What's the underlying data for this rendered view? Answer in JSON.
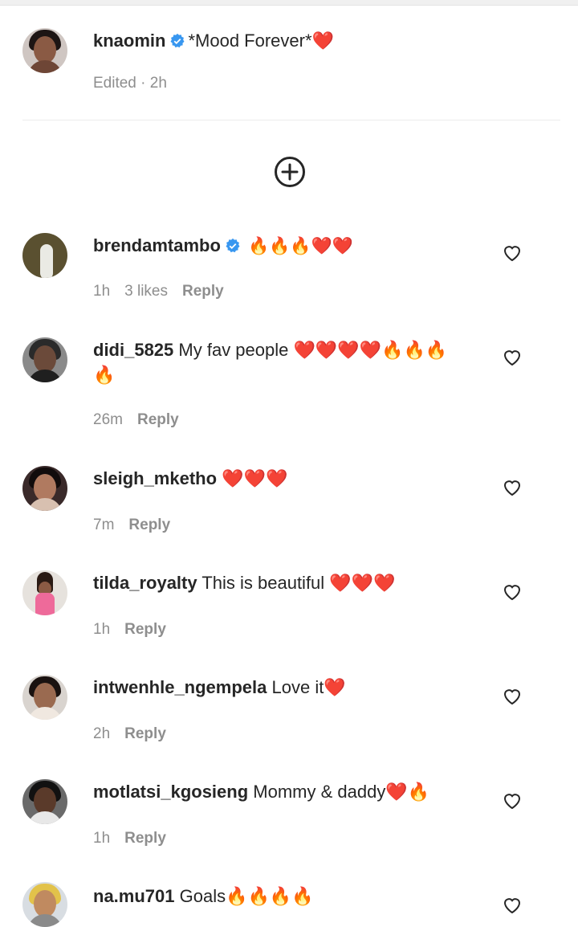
{
  "caption": {
    "username": "knaomin",
    "text": "*Mood Forever*❤️",
    "meta": "Edited · 2h"
  },
  "comments": [
    {
      "username": "brendamtambo",
      "verified": true,
      "text": "🔥🔥🔥❤️❤️",
      "time": "1h",
      "likes": "3 likes",
      "reply": "Reply"
    },
    {
      "username": "didi_5825",
      "text": "My fav people ❤️❤️❤️❤️🔥🔥🔥",
      "text2": "🔥",
      "time": "26m",
      "reply": "Reply"
    },
    {
      "username": "sleigh_mketho",
      "text": "❤️❤️❤️",
      "time": "7m",
      "reply": "Reply"
    },
    {
      "username": "tilda_royalty",
      "text": "This is beautiful ❤️❤️❤️",
      "time": "1h",
      "reply": "Reply"
    },
    {
      "username": "intwenhle_ngempela",
      "text": "Love it❤️",
      "time": "2h",
      "reply": "Reply"
    },
    {
      "username": "motlatsi_kgosieng",
      "text": "Mommy & daddy❤️🔥",
      "time": "1h",
      "reply": "Reply"
    },
    {
      "username": "na.mu701",
      "text": "Goals🔥🔥🔥🔥"
    }
  ],
  "icons": {
    "verified": "verified-badge-icon",
    "load_more": "plus-circle-icon",
    "like": "heart-outline-icon"
  },
  "colors": {
    "verified_blue": "#3897f0",
    "text": "#262626",
    "secondary": "#8e8e8e"
  }
}
